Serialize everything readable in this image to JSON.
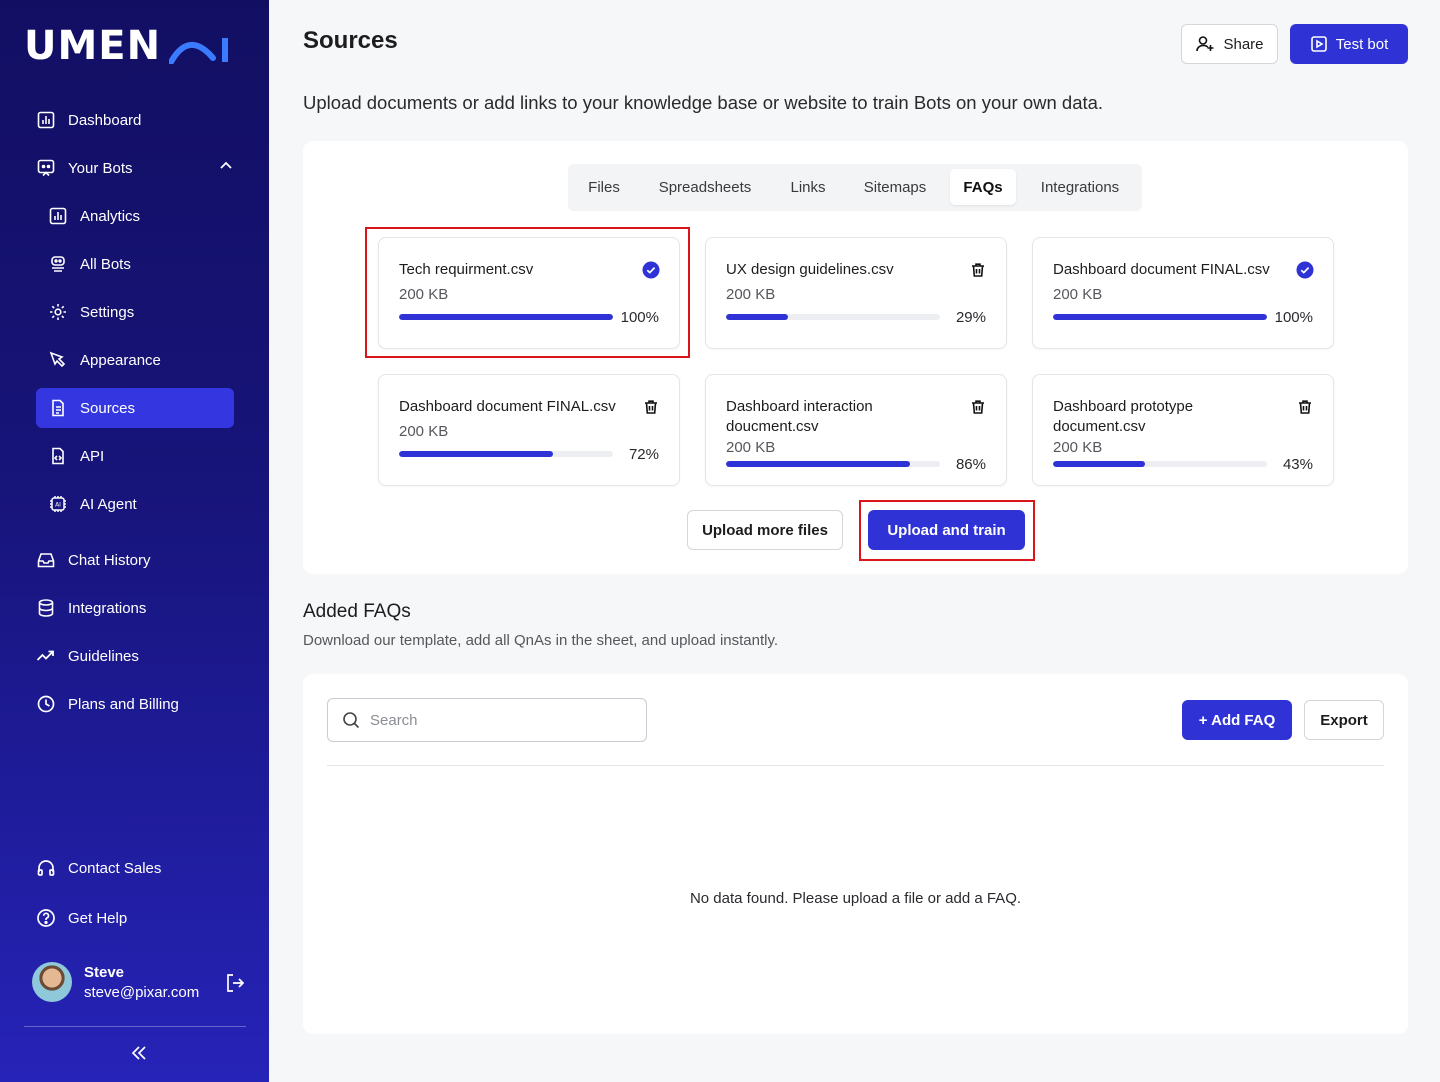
{
  "app": {
    "logo_text": "UMEN",
    "logo_ai": "AI"
  },
  "sidebar": {
    "items": [
      {
        "label": "Dashboard",
        "icon": "chart-icon"
      },
      {
        "label": "Your Bots",
        "icon": "bot-icon"
      },
      {
        "label": "Analytics",
        "icon": "analytics-icon"
      },
      {
        "label": "All Bots",
        "icon": "robot-icon"
      },
      {
        "label": "Settings",
        "icon": "gear-icon"
      },
      {
        "label": "Appearance",
        "icon": "pen-icon"
      },
      {
        "label": "Sources",
        "icon": "document-icon"
      },
      {
        "label": "API",
        "icon": "code-file-icon"
      },
      {
        "label": "AI Agent",
        "icon": "chip-icon"
      },
      {
        "label": "Chat History",
        "icon": "inbox-icon"
      },
      {
        "label": "Integrations",
        "icon": "database-icon"
      },
      {
        "label": "Guidelines",
        "icon": "trend-icon"
      },
      {
        "label": "Plans and Billing",
        "icon": "clock-icon"
      },
      {
        "label": "Contact Sales",
        "icon": "headphones-icon"
      },
      {
        "label": "Get Help",
        "icon": "help-icon"
      }
    ],
    "active": "Sources",
    "user": {
      "name": "Steve",
      "email": "steve@pixar.com"
    }
  },
  "header": {
    "title": "Sources",
    "share_label": "Share",
    "test_bot_label": "Test bot",
    "subtitle": "Upload documents or add links to your knowledge base or website to train Bots on your own data."
  },
  "tabs": [
    {
      "label": "Files"
    },
    {
      "label": "Spreadsheets"
    },
    {
      "label": "Links"
    },
    {
      "label": "Sitemaps"
    },
    {
      "label": "FAQs"
    },
    {
      "label": "Integrations"
    }
  ],
  "active_tab": "FAQs",
  "files": [
    {
      "name": "Tech requirment.csv",
      "size": "200 KB",
      "progress": 100,
      "progress_label": "100%",
      "status": "complete"
    },
    {
      "name": "UX design guidelines.csv",
      "size": "200 KB",
      "progress": 29,
      "progress_label": "29%",
      "status": "uploading"
    },
    {
      "name": "Dashboard document FINAL.csv",
      "size": "200 KB",
      "progress": 100,
      "progress_label": "100%",
      "status": "complete"
    },
    {
      "name": "Dashboard document FINAL.csv",
      "size": "200 KB",
      "progress": 72,
      "progress_label": "72%",
      "status": "uploading"
    },
    {
      "name": "Dashboard interaction doucment.csv",
      "size": "200 KB",
      "progress": 86,
      "progress_label": "86%",
      "status": "uploading"
    },
    {
      "name": "Dashboard prototype document.csv",
      "size": "200 KB",
      "progress": 43,
      "progress_label": "43%",
      "status": "uploading"
    }
  ],
  "actions": {
    "upload_more_label": "Upload more files",
    "upload_train_label": "Upload and train"
  },
  "faq_section": {
    "title": "Added FAQs",
    "description": "Download our template, add all QnAs in the sheet, and upload instantly.",
    "search_placeholder": "Search",
    "add_label": "+ Add FAQ",
    "export_label": "Export",
    "empty_message": "No data found. Please upload a file or add a FAQ."
  },
  "colors": {
    "accent": "#2f33d6",
    "sidebar_top": "#120f63",
    "sidebar_bottom": "#2623b8",
    "highlight": "#d9141b"
  }
}
